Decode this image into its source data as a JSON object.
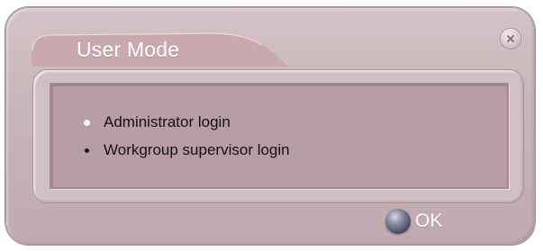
{
  "dialog": {
    "title": "User Mode",
    "options": [
      {
        "label": "Administrator login",
        "selected": true,
        "bullet": "white-dot"
      },
      {
        "label": "Workgroup supervisor login",
        "selected": false,
        "bullet": "black-dot"
      }
    ],
    "ok_label": "OK",
    "close_icon": "close-icon",
    "ok_icon": "orb-icon"
  },
  "colors": {
    "dialog_bg": "#c7b4b8",
    "inner_panel": "#b79ea4",
    "title_tab": "#c8a8af",
    "text": "#141012",
    "title_text": "#ffffff"
  }
}
